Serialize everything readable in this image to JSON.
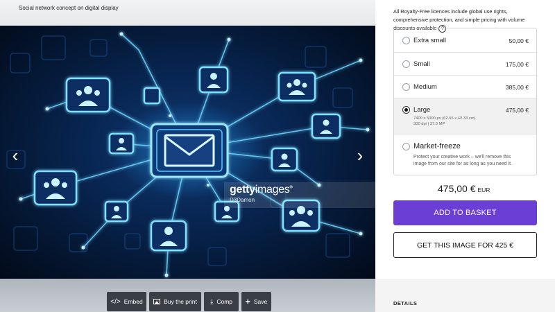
{
  "viewer": {
    "caption": "Social network concept on digital display",
    "image_id": "918939600",
    "watermark": {
      "brand_bold": "getty",
      "brand_light": "images",
      "registered": "®",
      "credit": "D3Damon"
    },
    "nav": {
      "prev": "‹",
      "next": "›"
    },
    "toolbar": [
      {
        "label": "Embed",
        "icon": "code-icon"
      },
      {
        "label": "Buy the print",
        "icon": "image-icon"
      },
      {
        "label": "Comp",
        "icon": "download-icon"
      },
      {
        "label": "Save",
        "icon": "plus-icon"
      }
    ]
  },
  "panel": {
    "licence_note": "All Royalty-Free licences include global use rights, comprehensive protection, and simple pricing with volume discounts available",
    "help_icon": "?",
    "options": [
      {
        "label": "Extra small",
        "price": "50,00 €",
        "selected": false
      },
      {
        "label": "Small",
        "price": "175,00 €",
        "selected": false
      },
      {
        "label": "Medium",
        "price": "385,00 €",
        "selected": false
      },
      {
        "label": "Large",
        "price": "475,00 €",
        "selected": true,
        "detail_1": "7400 x 5000 px (62.65 x 42.33 cm)",
        "detail_2": "300 dpi | 37.0 MP"
      }
    ],
    "market_freeze": {
      "label": "Market-freeze",
      "description": "Protect your creative work – we'll remove this image from our site for as long as you need it."
    },
    "total": {
      "amount": "475,00 €",
      "currency": "EUR"
    },
    "add_to_basket": "ADD TO BASKET",
    "get_image": "GET THIS IMAGE FOR 425 €",
    "details_title": "DETAILS"
  },
  "colors": {
    "accent": "#6b3fd4",
    "glow": "#49c8ff",
    "background_dark": "#06173a"
  }
}
